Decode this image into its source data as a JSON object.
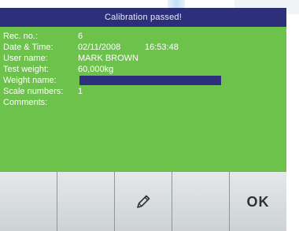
{
  "title": "Calibration passed!",
  "fields": {
    "rec_no": {
      "label": "Rec. no.:",
      "value": "6"
    },
    "date_time": {
      "label": "Date & Time:",
      "date": "02/11/2008",
      "time": "16:53:48"
    },
    "user_name": {
      "label": "User name:",
      "value": "MARK BROWN"
    },
    "test_weight": {
      "label": "Test weight:",
      "value": "60,000kg"
    },
    "weight_name": {
      "label": "Weight name:"
    },
    "scale_numbers": {
      "label": "Scale numbers:",
      "value": "1"
    },
    "comments": {
      "label": "Comments:"
    }
  },
  "softkeys": {
    "key1": "",
    "key2": "",
    "key3_icon": "pencil-icon",
    "key4": "",
    "key5": "OK"
  },
  "colors": {
    "screen_bg": "#6cc24a",
    "titlebar_bg": "#2e2f7a",
    "field_box": "#2e2f7a",
    "softkey_bg": "#cfd4d6"
  }
}
